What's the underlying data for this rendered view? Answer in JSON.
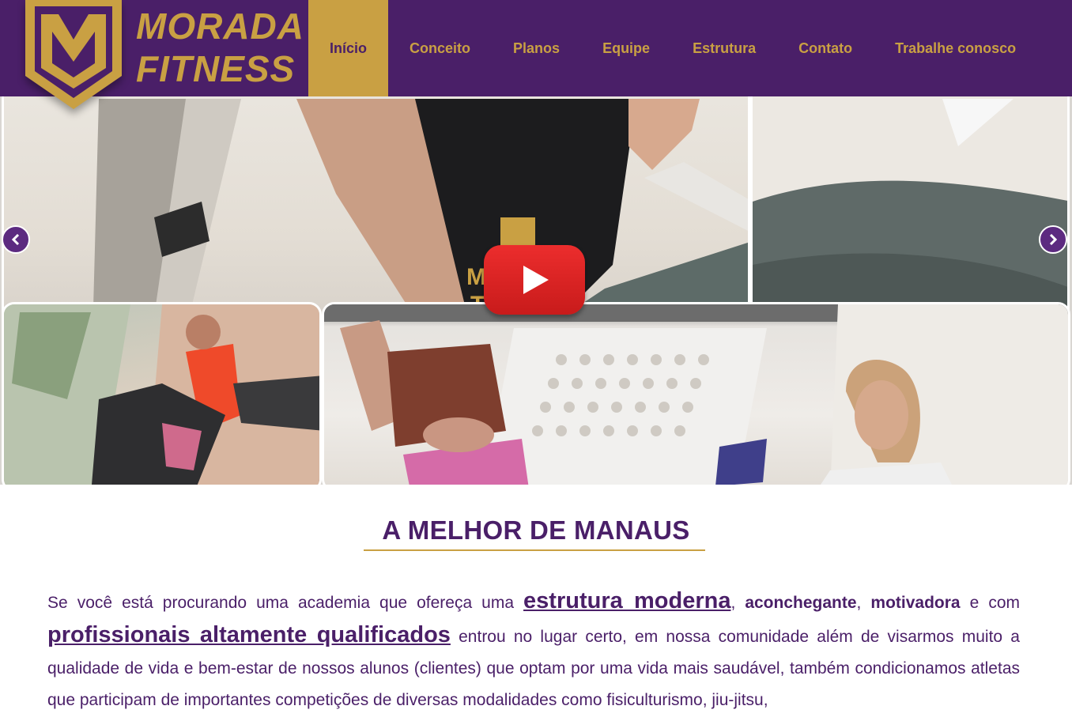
{
  "brand": {
    "name_line1": "MORADA",
    "name_line2": "FITNESS",
    "gold": "#c9a043",
    "purple": "#4a1f68"
  },
  "nav": {
    "items": [
      {
        "label": "Início",
        "active": true
      },
      {
        "label": "Conceito",
        "active": false
      },
      {
        "label": "Planos",
        "active": false
      },
      {
        "label": "Equipe",
        "active": false
      },
      {
        "label": "Estrutura",
        "active": false
      },
      {
        "label": "Contato",
        "active": false
      },
      {
        "label": "Trabalhe conosco",
        "active": false
      }
    ]
  },
  "hero": {
    "prev_icon": "chevron-left-icon",
    "next_icon": "chevron-right-icon",
    "play_icon": "youtube-play-icon",
    "shirt_logo_text": "MORADA FITNESS",
    "play_color": "#e02424"
  },
  "content": {
    "title": "A MELHOR DE MANAUS",
    "p_part1": "Se você está procurando uma academia que ofereça uma ",
    "link1": "estrutura moderna",
    "p_part2": ", ",
    "bold1": "aconchegante",
    "p_part3": ", ",
    "bold2": "motivadora",
    "p_part4": " e com ",
    "link2": "profissionais altamente qualificados",
    "p_part5": " entrou no lugar certo, em nossa comunidade além de visarmos muito a qualidade de vida e bem-estar de nossos alunos (clientes) que optam por uma vida mais saudável, também condicionamos atletas que participam de importantes competições de diversas modalidades como fisiculturismo, jiu-jitsu,"
  }
}
